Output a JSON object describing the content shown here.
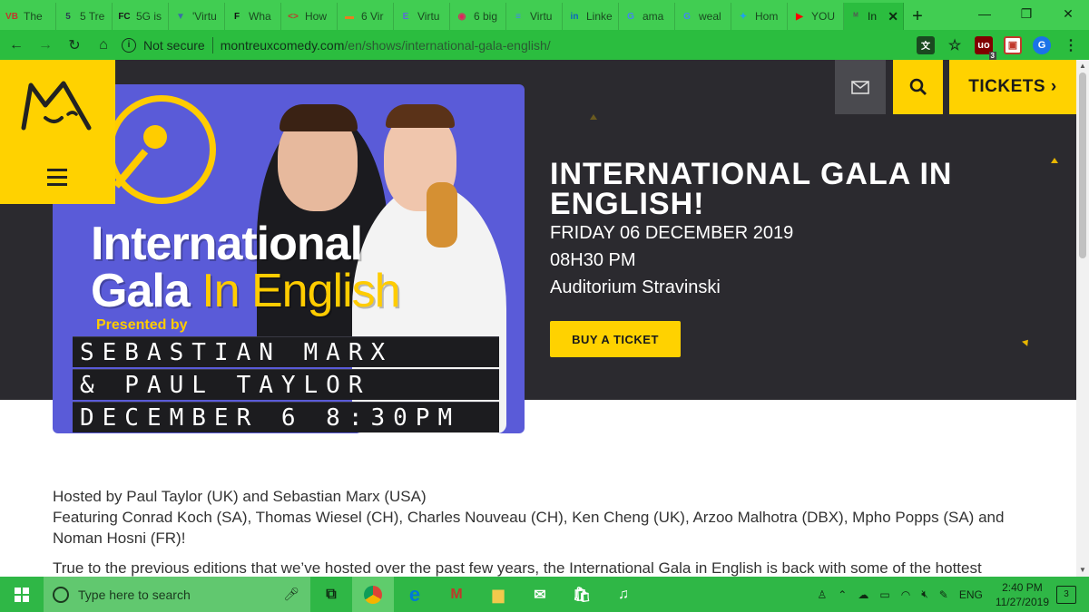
{
  "browser": {
    "tabs": [
      {
        "icon": "vb-icon",
        "favicon_text": "VB",
        "label": "The",
        "color": "#c0392b"
      },
      {
        "icon": "5-icon",
        "favicon_text": "5",
        "label": "5 Tre",
        "color": "#2c3e50"
      },
      {
        "icon": "fc-icon",
        "favicon_text": "FC",
        "label": "5G is",
        "color": "#1a1a1a"
      },
      {
        "icon": "virtu-icon",
        "favicon_text": "▼",
        "label": "'Virtu",
        "color": "#3a6ea5"
      },
      {
        "icon": "forbes-icon",
        "favicon_text": "F",
        "label": "Wha",
        "color": "#111"
      },
      {
        "icon": "code-icon",
        "favicon_text": "<>",
        "label": "How",
        "color": "#c0392b"
      },
      {
        "icon": "biz-icon",
        "favicon_text": "▬",
        "label": "6 Vir",
        "color": "#e67e22"
      },
      {
        "icon": "e-icon",
        "favicon_text": "E",
        "label": "Virtu",
        "color": "#5b6bd6"
      },
      {
        "icon": "red-circle-icon",
        "favicon_text": "◉",
        "label": "6 big",
        "color": "#e0245e"
      },
      {
        "icon": "doc-icon",
        "favicon_text": "≡",
        "label": "Virtu",
        "color": "#4285f4"
      },
      {
        "icon": "linkedin-icon",
        "favicon_text": "in",
        "label": "Linke",
        "color": "#0a66c2"
      },
      {
        "icon": "google-icon",
        "favicon_text": "G",
        "label": "ama",
        "color": "#4285f4"
      },
      {
        "icon": "google-icon",
        "favicon_text": "G",
        "label": "weal",
        "color": "#4285f4"
      },
      {
        "icon": "twitter-icon",
        "favicon_text": "✦",
        "label": "Hom",
        "color": "#1da1f2"
      },
      {
        "icon": "youtube-icon",
        "favicon_text": "▶",
        "label": "YOU",
        "color": "#ff0000"
      }
    ],
    "active_tab": {
      "label": "In",
      "close": "✕"
    },
    "new_tab": "+",
    "url_security": "Not secure",
    "url_host": "montreuxcomedy.com",
    "url_path": "/en/shows/international-gala-english/",
    "ext_badge": "3",
    "profile_initial": "G"
  },
  "site": {
    "tickets_label": "TICKETS ›",
    "poster": {
      "title_line1": "International",
      "title_line2_a": "Gala ",
      "title_line2_b": "In English",
      "presented_by": "Presented by",
      "board_rows": [
        "SEBASTIAN MARX",
        "& PAUL  TAYLOR",
        "DECEMBER 6  8:30PM"
      ]
    },
    "show": {
      "title": "INTERNATIONAL GALA IN ENGLISH!",
      "date": "FRIDAY 06 DECEMBER 2019",
      "time": "08H30 PM",
      "venue": "Auditorium Stravinski",
      "buy_label": "BUY A TICKET"
    },
    "body": {
      "hosts": "Hosted by Paul Taylor (UK) and Sebastian Marx (USA)",
      "featuring": "Featuring Conrad Koch (SA), Thomas Wiesel (CH), Charles Nouveau (CH), Ken Cheng (UK), Arzoo Malhotra (DBX), Mpho Popps (SA) and Noman Hosni (FR)!",
      "intro": "True to the previous editions that we’ve hosted over the past few years, the International Gala in English is back with some of the hottest"
    }
  },
  "taskbar": {
    "search_placeholder": "Type here to search",
    "language": "ENG",
    "time": "2:40 PM",
    "date": "11/27/2019",
    "notifications": "3"
  },
  "colors": {
    "accent": "#ffd200",
    "hero_bg": "#2b2a2f",
    "chrome_green": "#41cd52"
  }
}
